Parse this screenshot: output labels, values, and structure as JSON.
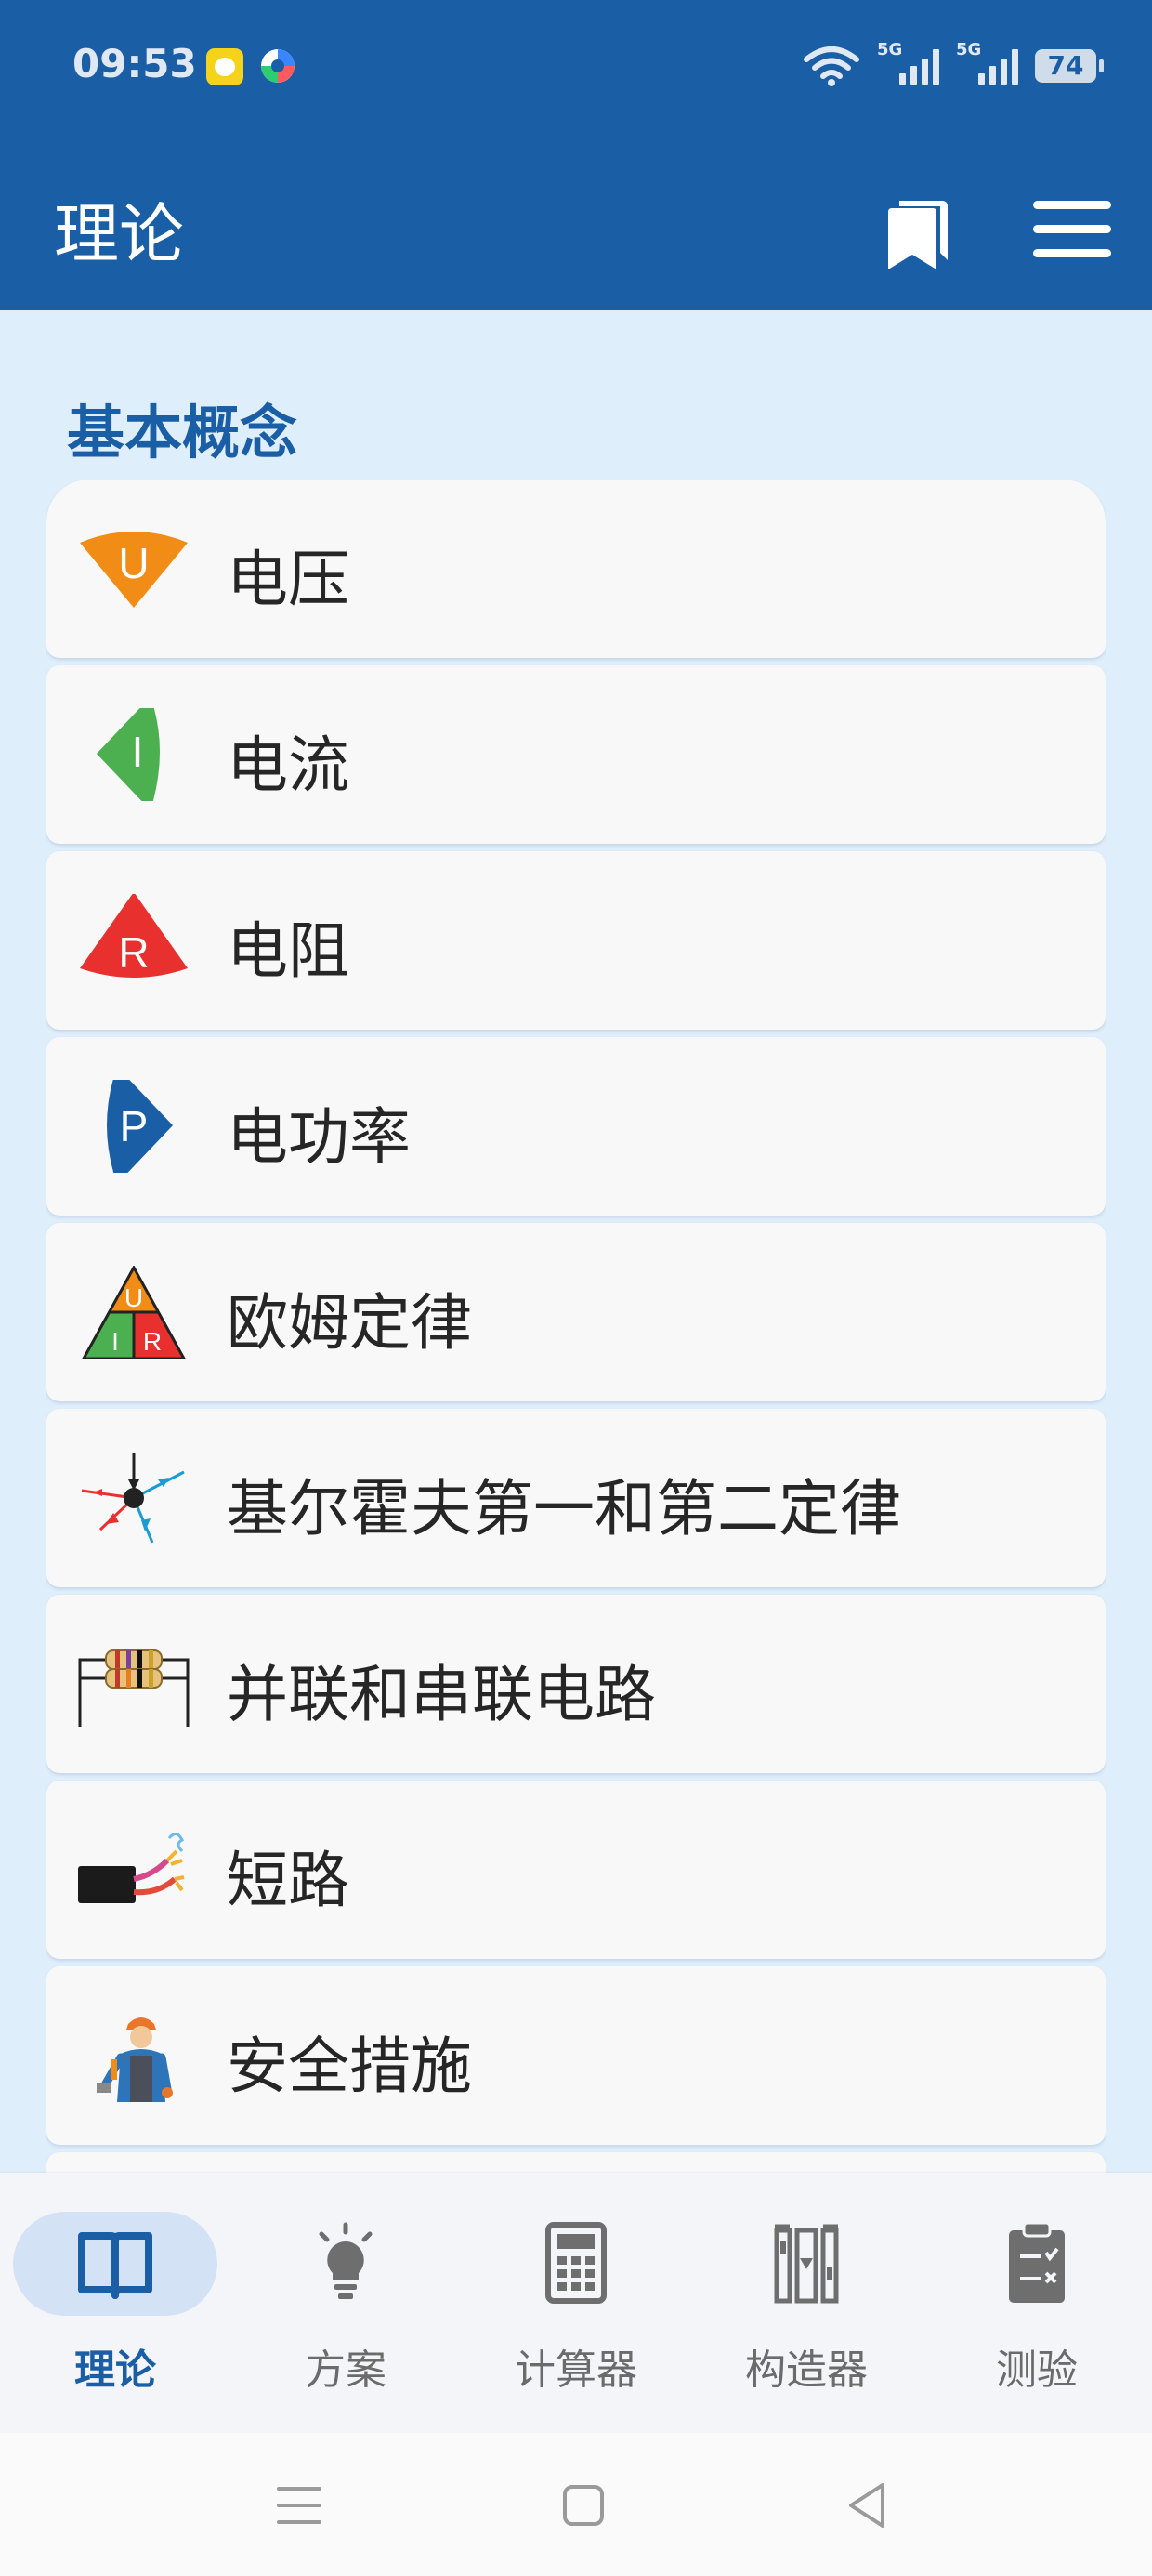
{
  "status_bar": {
    "time": "09:53",
    "network_1": "5G",
    "network_2": "5G",
    "battery": "74",
    "icons": [
      "wifi-icon",
      "signal-icon",
      "signal-icon",
      "battery-icon"
    ]
  },
  "app_bar": {
    "title": "理论",
    "actions": [
      "bookmark-icon",
      "menu-icon"
    ]
  },
  "section": {
    "title": "基本概念"
  },
  "items": [
    {
      "label": "电压",
      "icon": "voltage-u-icon",
      "color": "#f18c17"
    },
    {
      "label": "电流",
      "icon": "current-i-icon",
      "color": "#4caf50"
    },
    {
      "label": "电阻",
      "icon": "resistance-r-icon",
      "color": "#e8302f"
    },
    {
      "label": "电功率",
      "icon": "power-p-icon",
      "color": "#1a5ea6"
    },
    {
      "label": "欧姆定律",
      "icon": "ohms-law-triangle-icon"
    },
    {
      "label": "基尔霍夫第一和第二定律",
      "icon": "kirchhoff-node-icon"
    },
    {
      "label": "并联和串联电路",
      "icon": "resistor-circuit-icon"
    },
    {
      "label": "短路",
      "icon": "short-circuit-wire-icon"
    },
    {
      "label": "安全措施",
      "icon": "electrician-worker-icon"
    }
  ],
  "ohms_triangle": {
    "top": "U",
    "left": "I",
    "right": "R"
  },
  "bottom_nav": [
    {
      "label": "理论",
      "icon": "book-icon",
      "active": true
    },
    {
      "label": "方案",
      "icon": "lightbulb-icon",
      "active": false
    },
    {
      "label": "计算器",
      "icon": "calculator-icon",
      "active": false
    },
    {
      "label": "构造器",
      "icon": "components-icon",
      "active": false
    },
    {
      "label": "测验",
      "icon": "quiz-clipboard-icon",
      "active": false
    }
  ],
  "colors": {
    "primary": "#1a5ea6",
    "background": "#dfeefb",
    "card": "#f8f8f9"
  }
}
